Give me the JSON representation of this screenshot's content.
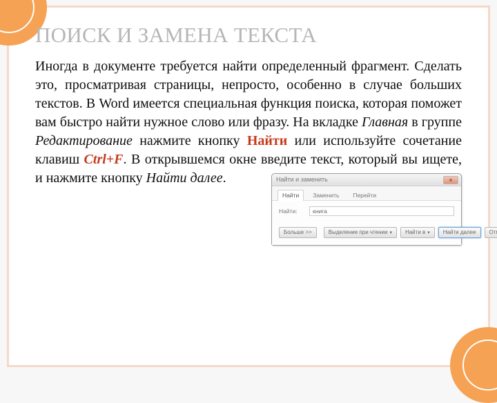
{
  "title": "ПОИСК И ЗАМЕНА ТЕКСТА",
  "para": {
    "p1": "Иногда в документе требуется найти определенный фрагмент. Сделать это, просматривая страницы, непросто, особенно в случае больших текстов. В Word имеется специальная функция поиска, которая поможет вам быстро найти нужное слово или фразу. На вкладке ",
    "tab": "Главная",
    "p2": " в группе ",
    "group": "Редактирование",
    "p3": " нажмите кнопку ",
    "btn": "Найти",
    "p4": " или используйте сочетание клавиш ",
    "hotkey": "Ctrl+F",
    "p5": ". В открывшемся окне введите текст, который вы ищете, и нажмите кнопку ",
    "next": "Найти далее",
    "p6": "."
  },
  "dialog": {
    "title": "Найти и заменить",
    "close": "×",
    "tabs": {
      "find": "Найти",
      "replace": "Заменить",
      "goto": "Перейти"
    },
    "field_label": "Найти:",
    "field_value": "книга",
    "buttons": {
      "more": "Больше >>",
      "reading": "Выделение при чтении",
      "find_in": "Найти в",
      "find_next": "Найти далее",
      "cancel": "Отмена"
    }
  }
}
